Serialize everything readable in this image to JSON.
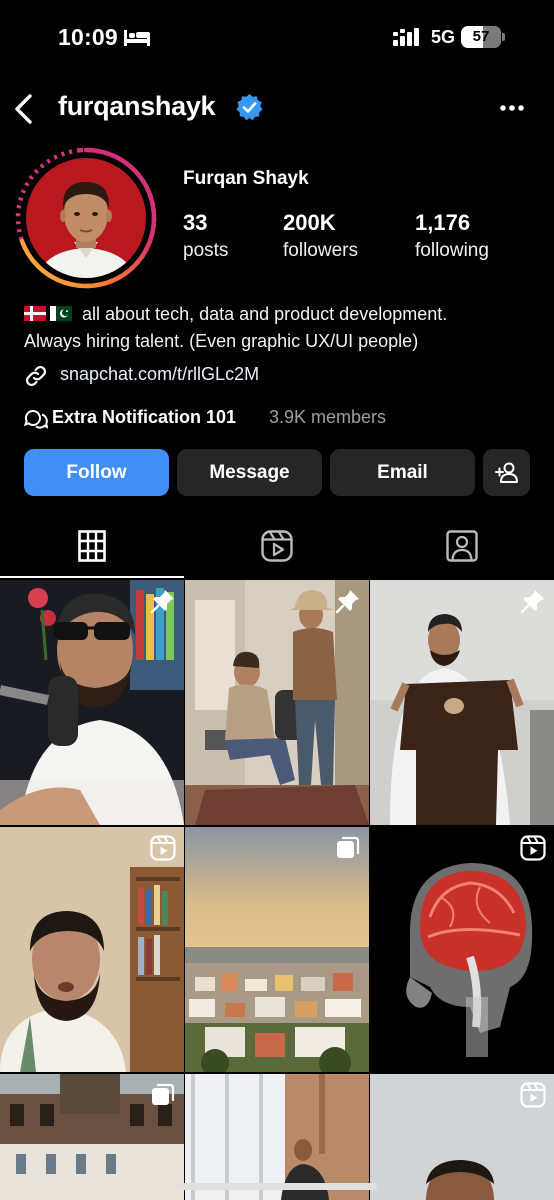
{
  "status_bar": {
    "time": "10:09",
    "network": "5G",
    "battery": "57"
  },
  "header": {
    "username": "furqanshayk"
  },
  "profile": {
    "display_name": "Furqan Shayk",
    "stats": [
      {
        "value": "33",
        "label": "posts"
      },
      {
        "value": "200K",
        "label": "followers"
      },
      {
        "value": "1,176",
        "label": "following"
      }
    ],
    "bio_line1": "all about tech, data and product development.",
    "bio_line2": "Always hiring talent. (Even graphic UX/UI people)",
    "link": "snapchat.com/t/rllGLc2M",
    "channel_name": "Extra Notification 101",
    "channel_members": "3.9K members"
  },
  "actions": {
    "follow": "Follow",
    "message": "Message",
    "email": "Email"
  },
  "tabs": [
    {
      "name": "grid-tab",
      "icon": "grid-icon",
      "active": true
    },
    {
      "name": "reels-tab",
      "icon": "reels-icon",
      "active": false
    },
    {
      "name": "tagged-tab",
      "icon": "tagged-person-icon",
      "active": false
    }
  ],
  "posts": [
    {
      "badge": "pin-icon"
    },
    {
      "badge": "pin-icon"
    },
    {
      "badge": "pin-icon"
    },
    {
      "badge": "reels-icon"
    },
    {
      "badge": "carousel-icon"
    },
    {
      "badge": "reels-icon"
    },
    {
      "badge": "carousel-icon"
    },
    {
      "badge": "none"
    },
    {
      "badge": "reels-icon"
    }
  ],
  "colors": {
    "accent": "#3f8ff7",
    "button_bg": "#262626",
    "background": "#000000",
    "verified": "#3897f0"
  }
}
